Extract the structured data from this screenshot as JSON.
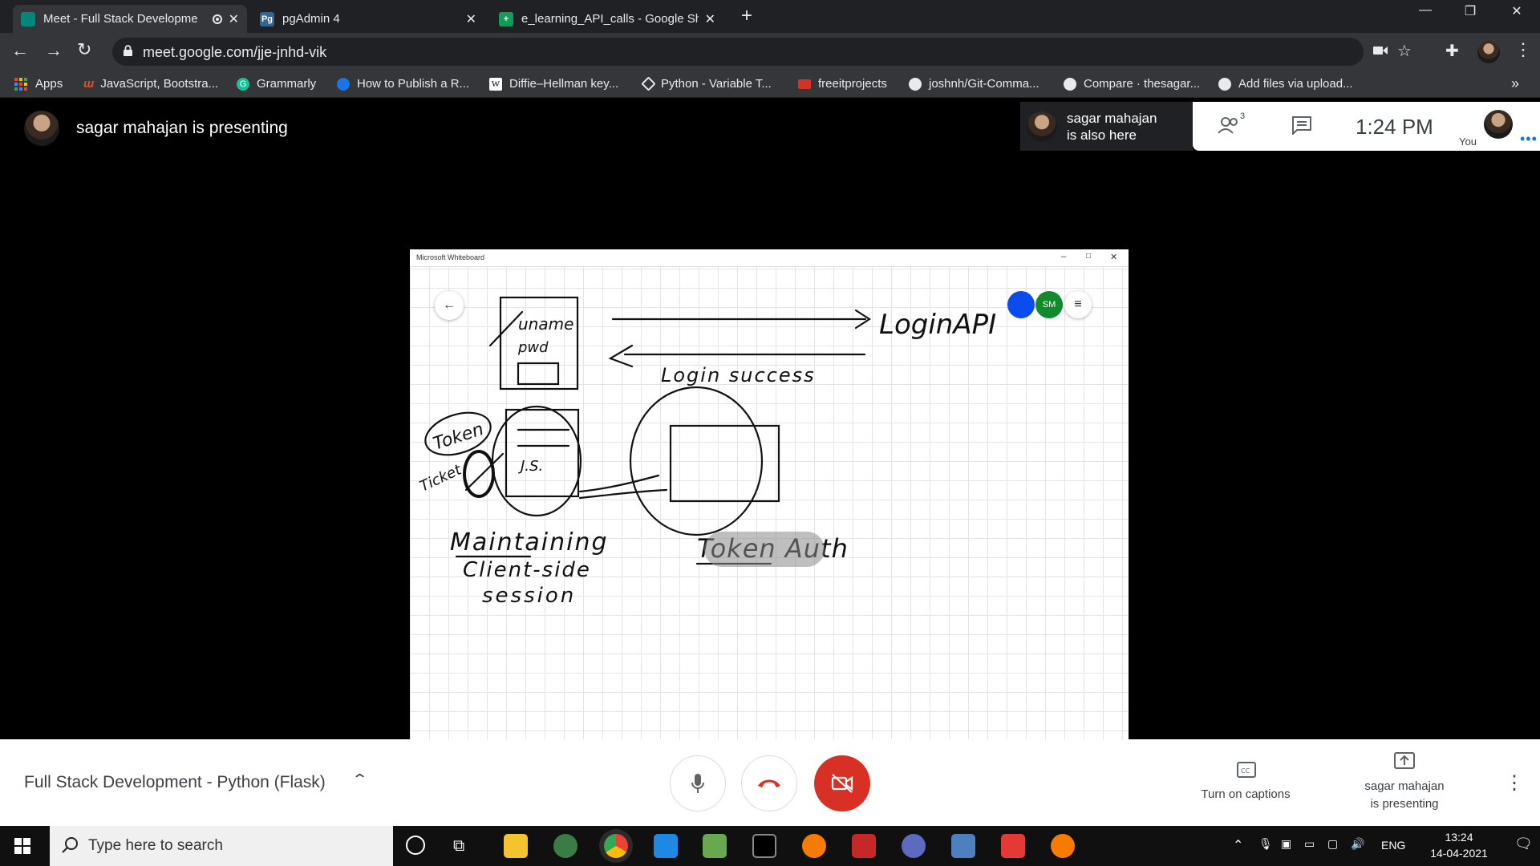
{
  "browser": {
    "tabs": [
      {
        "title": "Meet - Full Stack Developme",
        "active": true
      },
      {
        "title": "pgAdmin 4",
        "favicon": "Pg",
        "active": false
      },
      {
        "title": "e_learning_API_calls - Google She",
        "active": false
      }
    ],
    "new_tab": "+",
    "url": "meet.google.com/jje-jnhd-vik",
    "bookmarks": [
      "Apps",
      "JavaScript, Bootstra...",
      "Grammarly",
      "How to Publish a R...",
      "Diffie–Hellman key...",
      "Python - Variable T...",
      "freeitprojects",
      "joshnh/Git-Comma...",
      "Compare · thesagar...",
      "Add files via upload..."
    ],
    "bookmarks_overflow": "»"
  },
  "meet": {
    "presenting_banner": "sagar mahajan is presenting",
    "also_here_line1": "sagar mahajan",
    "also_here_line2": "is also here",
    "participant_count": "3",
    "time": "1:24 PM",
    "self_label": "You",
    "meeting_title": "Full Stack Development - Python (Flask)",
    "captions_label": "Turn on captions",
    "presenting_label_line1": "sagar mahajan",
    "presenting_label_line2": "is presenting",
    "colors": {
      "end_call": "#d93025",
      "camera_off": "#d93025"
    }
  },
  "whiteboard": {
    "app_title": "Microsoft Whiteboard",
    "participants": [
      "person-icon",
      "SM"
    ],
    "participant_colors": [
      "#0b4cf0",
      "#108a2c"
    ],
    "handwriting": [
      "uname",
      "pwd",
      "LoginAPI",
      "Login success",
      "Token",
      "Ticket",
      "J.S.",
      "Maintaining",
      "Client-side",
      "session",
      "Token Auth"
    ]
  },
  "taskbar": {
    "search_placeholder": "Type here to search",
    "language": "ENG",
    "clock_time": "13:24",
    "clock_date": "14-04-2021"
  }
}
